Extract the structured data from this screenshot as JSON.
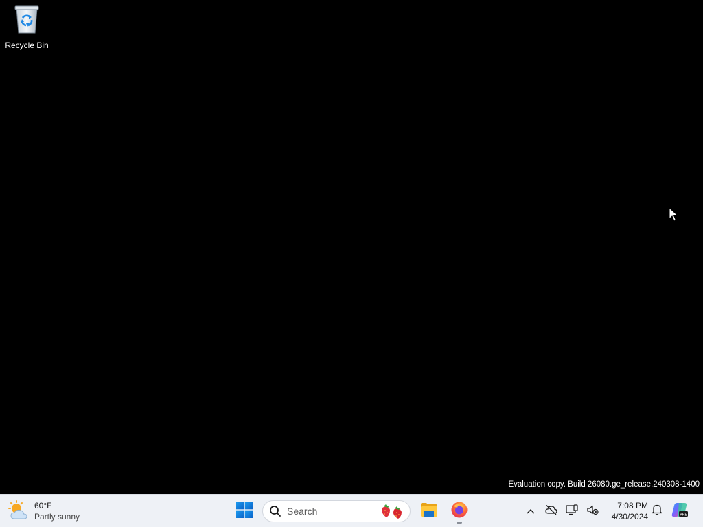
{
  "desktop": {
    "icons": [
      {
        "label": "Recycle Bin",
        "icon": "recycle-bin-icon"
      }
    ],
    "watermark": "Evaluation copy. Build 26080.ge_release.240308-1400",
    "background_color": "#000000"
  },
  "taskbar": {
    "background_color": "#eef1f6",
    "weather": {
      "temperature": "60°F",
      "condition": "Partly sunny",
      "icon": "partly-sunny-icon"
    },
    "start": {
      "icon": "windows-logo-icon",
      "accent": "#0a74da"
    },
    "search": {
      "placeholder": "Search",
      "icon": "search-icon",
      "highlight_icon": "strawberries-icon"
    },
    "apps": [
      {
        "name": "File Explorer",
        "icon": "file-explorer-icon",
        "running": false
      },
      {
        "name": "Firefox",
        "icon": "firefox-icon",
        "running": true
      }
    ],
    "tray": {
      "overflow_icon": "chevron-up-icon",
      "network_icon": "cloud-offline-icon",
      "display_icon": "display-icon",
      "volume_icon": "volume-muted-icon",
      "notifications_icon": "bell-icon",
      "copilot_icon": "copilot-icon",
      "copilot_badge": "PRE"
    },
    "clock": {
      "time": "7:08 PM",
      "date": "4/30/2024"
    }
  }
}
